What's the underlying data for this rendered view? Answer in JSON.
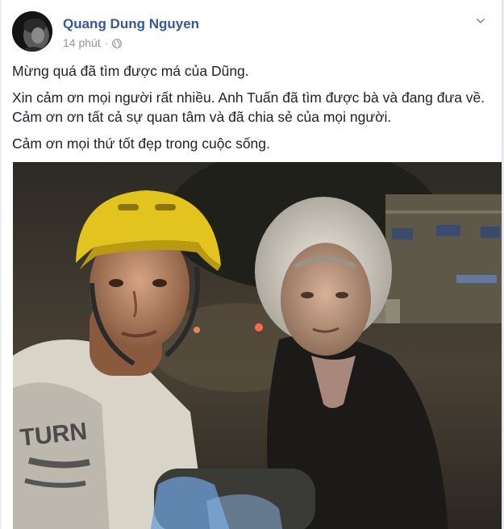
{
  "post": {
    "author": "Quang Dung Nguyen",
    "time": "14 phút",
    "separator": "·",
    "privacy_icon": "globe-icon",
    "menu_icon": "chevron-down-icon",
    "paragraphs": [
      "Mừng quá đã tìm được má của Dũng.",
      "Xin cảm ơn mọi người rất nhiều. Anh Tuấn đã tìm được bà và đang đưa về. Cảm ơn ơn tất cả sự quan tâm và đã chia sẻ của mọi người.",
      "Cảm ơn mọi thứ tốt đẹp trong cuộc sống."
    ],
    "photo_shirt_text": "TURN"
  },
  "colors": {
    "author": "#365899",
    "meta": "#90949c",
    "text": "#1d2129",
    "helmet": "#e8c81e"
  }
}
